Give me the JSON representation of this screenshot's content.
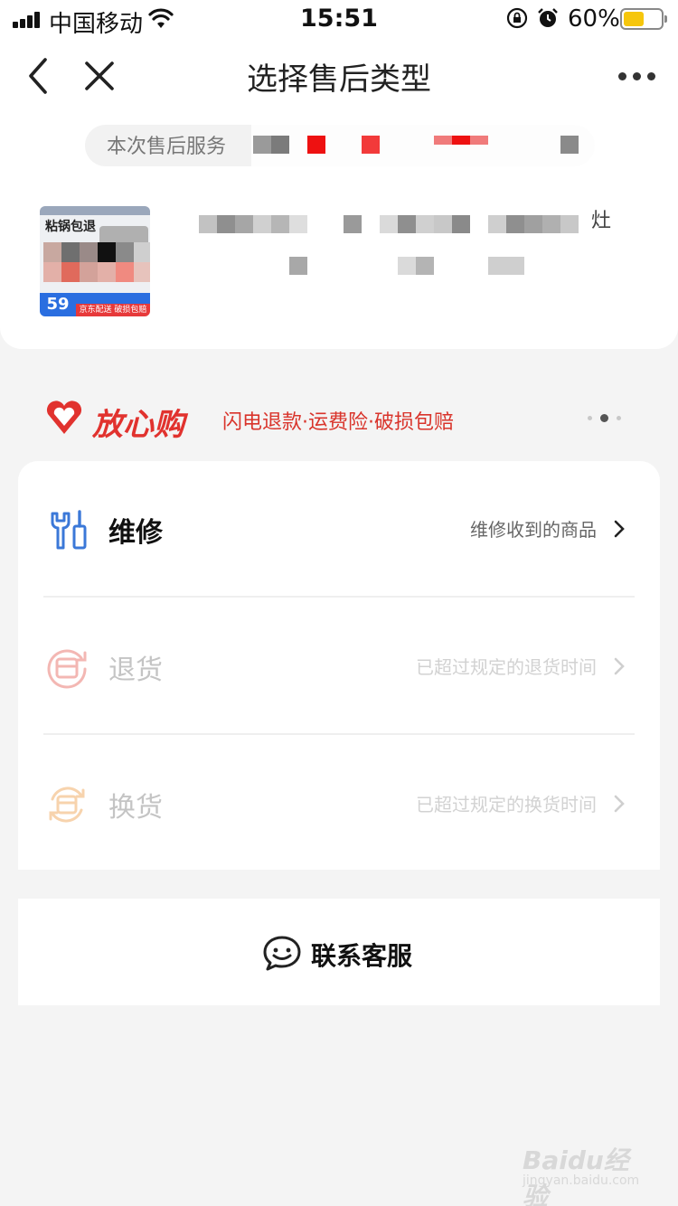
{
  "status_bar": {
    "carrier": "中国移动",
    "time": "15:51",
    "battery_percent": "60%",
    "battery_level": 0.6,
    "icons": [
      "signal-icon",
      "wifi-icon",
      "orientation-lock-icon",
      "alarm-icon",
      "battery-icon"
    ]
  },
  "nav": {
    "title": "选择售后类型",
    "back_icon": "back-chevron-icon",
    "close_icon": "close-icon",
    "more_icon": "more-dots-icon"
  },
  "product": {
    "service_label": "本次售后服务",
    "name_tail": "灶",
    "thumb": {
      "title": "粘锅包退",
      "price": "59",
      "tag": "京东配送 破损包赔"
    }
  },
  "assurance": {
    "brand": "放心购",
    "features": "闪电退款·运费险·破损包赔",
    "pager_dots": 3,
    "active_dot": 1
  },
  "options": [
    {
      "label": "维修",
      "desc": "维修收到的商品",
      "enabled": true,
      "icon": "repair-tools-icon"
    },
    {
      "label": "退货",
      "desc": "已超过规定的退货时间",
      "enabled": false,
      "icon": "return-box-icon"
    },
    {
      "label": "换货",
      "desc": "已超过规定的换货时间",
      "enabled": false,
      "icon": "exchange-box-icon"
    }
  ],
  "contact": {
    "label": "联系客服",
    "icon": "customer-service-chat-icon"
  },
  "watermark": {
    "logo": "Baidu经验",
    "sub": "jingyan.baidu.com"
  },
  "colors": {
    "accent_red": "#e1322e",
    "repair_blue": "#3b78d8",
    "return_pink": "#f3b7b3",
    "exchange_orange": "#f7d3ad",
    "battery_yellow": "#f6c60c",
    "price_blue": "#2a6ee0"
  }
}
